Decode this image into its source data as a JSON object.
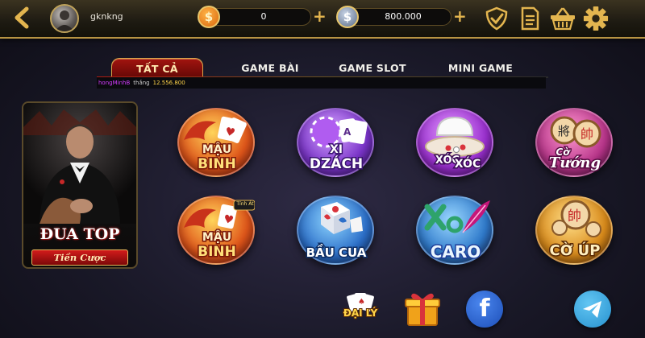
{
  "header": {
    "username": "gknkng",
    "gold_balance": "0",
    "silver_balance": "800.000",
    "gold_symbol": "$",
    "silver_symbol": "$",
    "plus_label": "+"
  },
  "tabs": [
    {
      "label": "TẤT CẢ",
      "active": true
    },
    {
      "label": "GAME BÀI",
      "active": false
    },
    {
      "label": "GAME SLOT",
      "active": false
    },
    {
      "label": "MINI GAME",
      "active": false
    }
  ],
  "ticker": {
    "name": "hongMinhB",
    "word": "thắng",
    "amount": "12.556.800"
  },
  "promo": {
    "title": "ĐUA TOP",
    "subtitle": "Tiền Cược"
  },
  "games": [
    {
      "line1": "MẬU",
      "line2": "BINH"
    },
    {
      "line1": "XI",
      "line2": "DZÁCH"
    },
    {
      "line1": "XÓC",
      "line2": "XÓC"
    },
    {
      "line1": "Cờ",
      "line2": "Tướng"
    },
    {
      "line1": "MẬU",
      "line2": "BINH",
      "badge": "Tính Át"
    },
    {
      "line1": "",
      "line2": "BẦU CUA"
    },
    {
      "line1": "",
      "line2": "CARO"
    },
    {
      "line1": "",
      "line2": "CỜ ÚP"
    }
  ],
  "bottom": {
    "agent_label": "ĐẠI LÝ",
    "facebook_letter": "f"
  },
  "colors": {
    "gold": "#d6aa4c",
    "active_tab": "#a2140f",
    "ticker_name": "#d43cff",
    "ticker_amount": "#ffd54a"
  }
}
